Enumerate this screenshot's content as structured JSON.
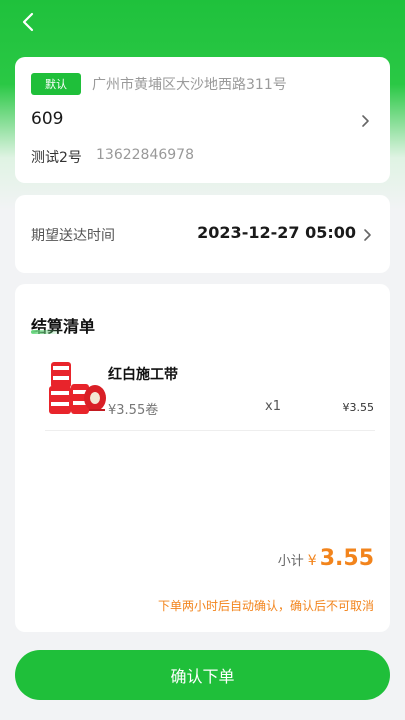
{
  "nav": {
    "back_icon": "chevron-left-icon"
  },
  "address": {
    "badge": "默认",
    "region": "广州市黄埔区大沙地西路311号",
    "detail": "609",
    "contact_name": "测试2号",
    "contact_phone": "13622846978"
  },
  "delivery": {
    "label": "期望送达时间",
    "value": "2023-12-27 05:00"
  },
  "order": {
    "title": "结算清单",
    "items": [
      {
        "name": "红白施工带",
        "unit_price": "¥3.55卷",
        "quantity": "x1",
        "total": "¥3.55"
      }
    ],
    "subtotal_label": "小计",
    "subtotal_symbol": "¥",
    "subtotal_value": "3.55",
    "notice": "下单两小时后自动确认，确认后不可取消"
  },
  "submit": {
    "label": "确认下单"
  },
  "colors": {
    "primary": "#1fbf3a",
    "accent": "#f2841c",
    "background": "#f2f3f5"
  }
}
